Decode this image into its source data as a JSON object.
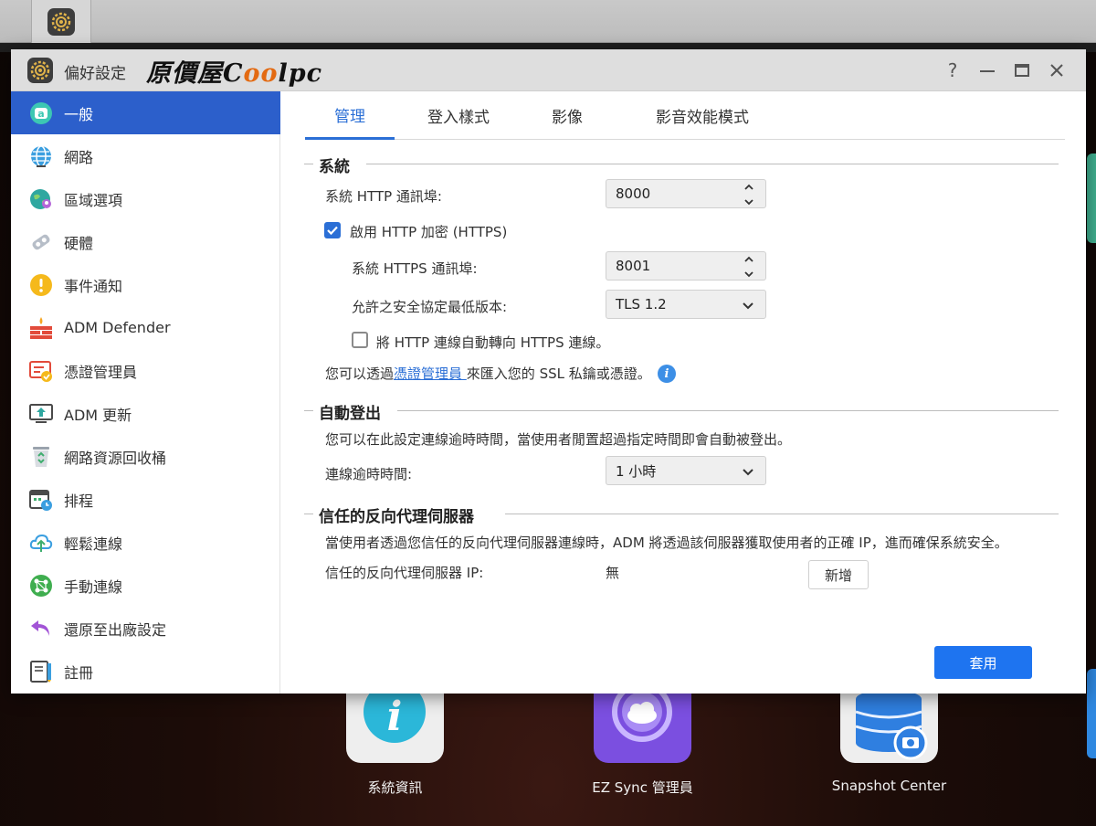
{
  "taskbar": {
    "active_app_icon": "preferences-gear-icon"
  },
  "window": {
    "title": "偏好設定",
    "brand": {
      "text_main": "原價屋C",
      "text_accent": "oo",
      "text_tail": "lpc"
    },
    "controls": {
      "help": "?",
      "minimize": "—",
      "maximize": "☐",
      "close": "✕"
    }
  },
  "sidebar": {
    "items": [
      {
        "label": "一般",
        "icon": "general-icon",
        "active": true
      },
      {
        "label": "網路",
        "icon": "globe-icon"
      },
      {
        "label": "區域選項",
        "icon": "region-icon"
      },
      {
        "label": "硬體",
        "icon": "hardware-icon"
      },
      {
        "label": "事件通知",
        "icon": "alert-icon"
      },
      {
        "label": "ADM Defender",
        "icon": "firewall-icon"
      },
      {
        "label": "憑證管理員",
        "icon": "certificate-icon"
      },
      {
        "label": "ADM 更新",
        "icon": "update-icon"
      },
      {
        "label": "網路資源回收桶",
        "icon": "recycle-bin-icon"
      },
      {
        "label": "排程",
        "icon": "schedule-icon"
      },
      {
        "label": "輕鬆連線",
        "icon": "cloud-connect-icon"
      },
      {
        "label": "手動連線",
        "icon": "network-icon"
      },
      {
        "label": "還原至出廠設定",
        "icon": "restore-icon"
      },
      {
        "label": "註冊",
        "icon": "register-icon"
      }
    ]
  },
  "tabs": [
    {
      "label": "管理",
      "active": true
    },
    {
      "label": "登入樣式"
    },
    {
      "label": "影像"
    },
    {
      "label": "影音效能模式"
    }
  ],
  "system": {
    "heading": "系統",
    "http_port_label": "系統 HTTP 通訊埠:",
    "http_port_value": "8000",
    "https_enable_label": "啟用 HTTP 加密 (HTTPS)",
    "https_enabled": true,
    "https_port_label": "系統 HTTPS 通訊埠:",
    "https_port_value": "8001",
    "tls_label": "允許之安全協定最低版本:",
    "tls_value": "TLS 1.2",
    "redirect_label": "將 HTTP 連線自動轉向 HTTPS 連線。",
    "redirect_enabled": false,
    "ssl_note_prefix": "您可以透過",
    "ssl_note_link": "憑證管理員 ",
    "ssl_note_suffix": "來匯入您的 SSL 私鑰或憑證。"
  },
  "auto_logout": {
    "heading": "自動登出",
    "description": "您可以在此設定連線逾時時間，當使用者閒置超過指定時間即會自動被登出。",
    "timeout_label": "連線逾時時間:",
    "timeout_value": "1 小時"
  },
  "proxy": {
    "heading": "信任的反向代理伺服器",
    "description": "當使用者透過您信任的反向代理伺服器連線時，ADM 將透過該伺服器獲取使用者的正確 IP，進而確保系統安全。",
    "ip_label": "信任的反向代理伺服器 IP:",
    "ip_value": "無",
    "add_button": "新增"
  },
  "apply_button": "套用",
  "desktop": {
    "apps": [
      {
        "label": "系統資訊",
        "icon": "system-info-icon",
        "color": "#2bb7d9"
      },
      {
        "label": "EZ Sync 管理員",
        "icon": "ez-sync-icon",
        "color": "#7b4fe0"
      },
      {
        "label": "Snapshot Center",
        "icon": "snapshot-center-icon",
        "color": "#2f7fe0"
      }
    ]
  }
}
